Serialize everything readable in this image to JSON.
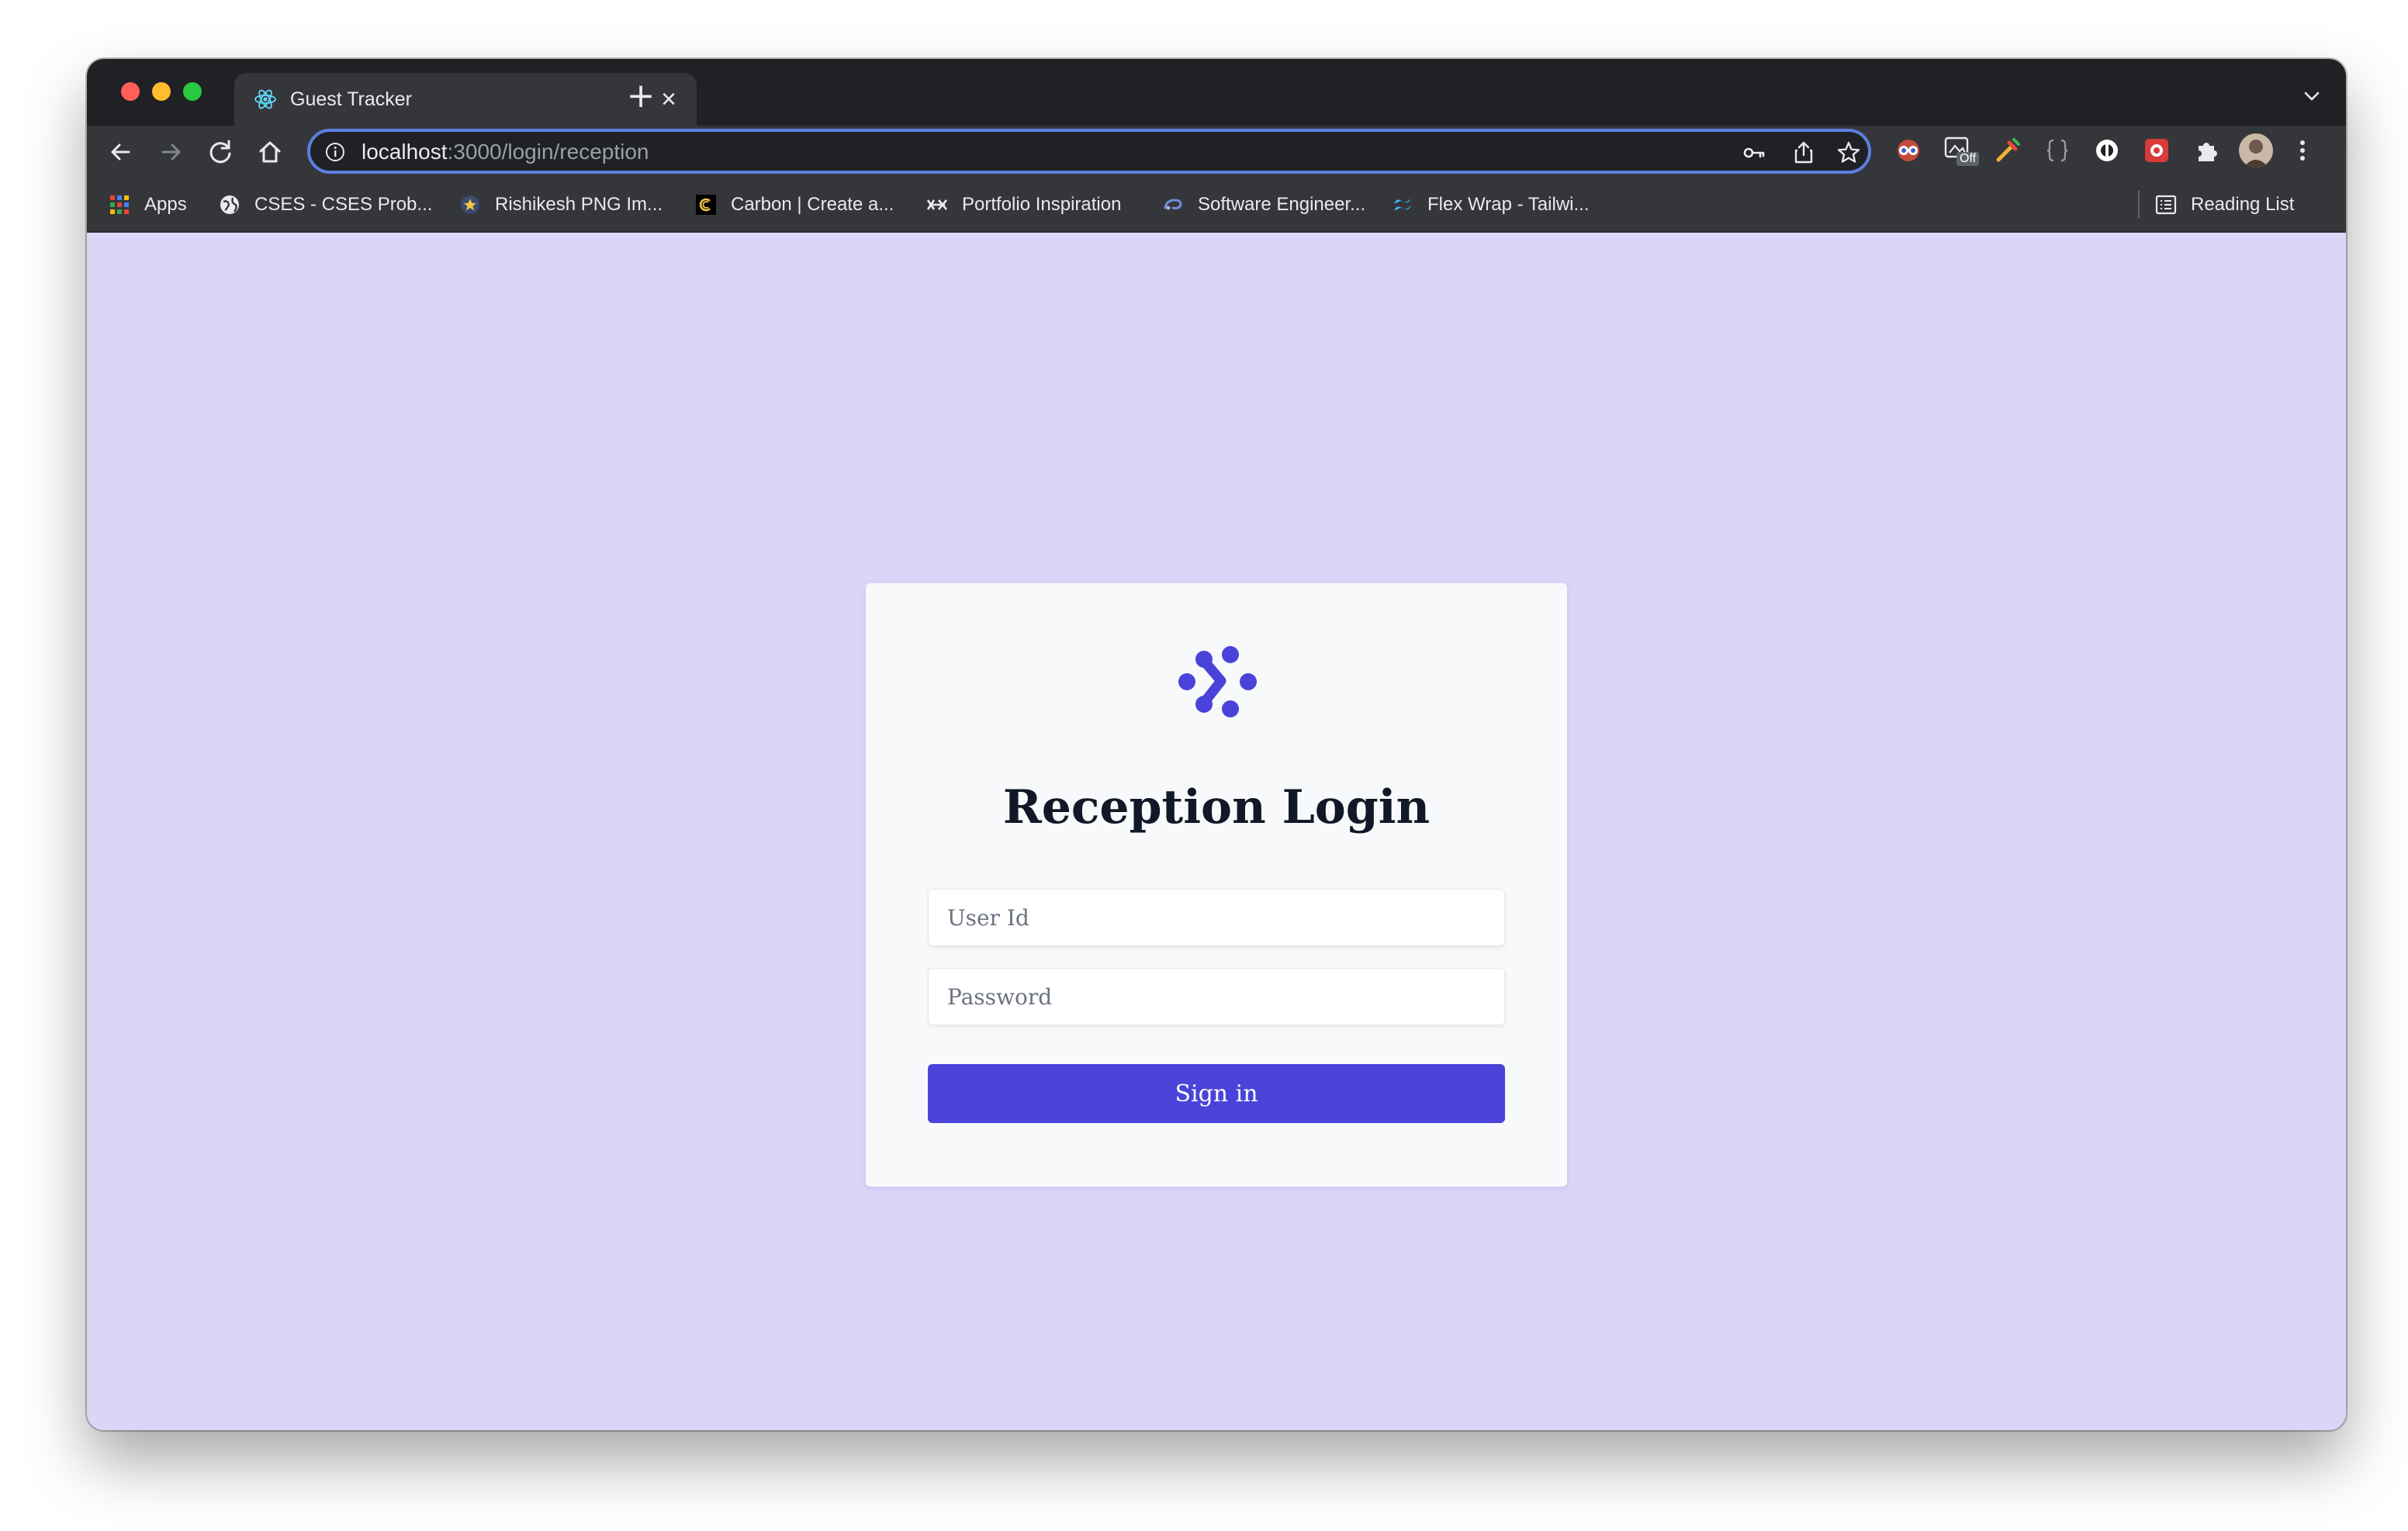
{
  "browser": {
    "tab": {
      "title": "Guest Tracker",
      "close_glyph": "×",
      "icon": "react-logo-icon"
    },
    "new_tab_glyph": "+",
    "address": {
      "host": "localhost",
      "rest": ":3000/login/reception"
    },
    "bookmarks": [
      {
        "label": "Apps",
        "icon": "apps-grid-icon"
      },
      {
        "label": "CSES - CSES Prob...",
        "icon": "globe-icon"
      },
      {
        "label": "Rishikesh PNG Im...",
        "icon": "star-badge-icon"
      },
      {
        "label": "Carbon | Create a...",
        "icon": "carbon-logo-icon"
      },
      {
        "label": "Portfolio Inspiration",
        "icon": "portfolio-logo-icon"
      },
      {
        "label": "Software Engineer...",
        "icon": "swirl-logo-icon"
      },
      {
        "label": "Flex Wrap - Tailwi...",
        "icon": "tailwind-logo-icon"
      }
    ],
    "reading_list": {
      "label": "Reading List",
      "icon": "reading-list-icon"
    },
    "extension_badge": "Off"
  },
  "login": {
    "title": "Reception Login",
    "user_placeholder": "User Id",
    "password_placeholder": "Password",
    "submit_label": "Sign in"
  },
  "colors": {
    "page_bg": "#dcd5f8",
    "card_bg": "#f8f9fb",
    "accent": "#4a43d9",
    "chrome_dark": "#202124",
    "chrome_toolbar": "#35363a",
    "omnibox_focus": "#5c7fe0"
  }
}
